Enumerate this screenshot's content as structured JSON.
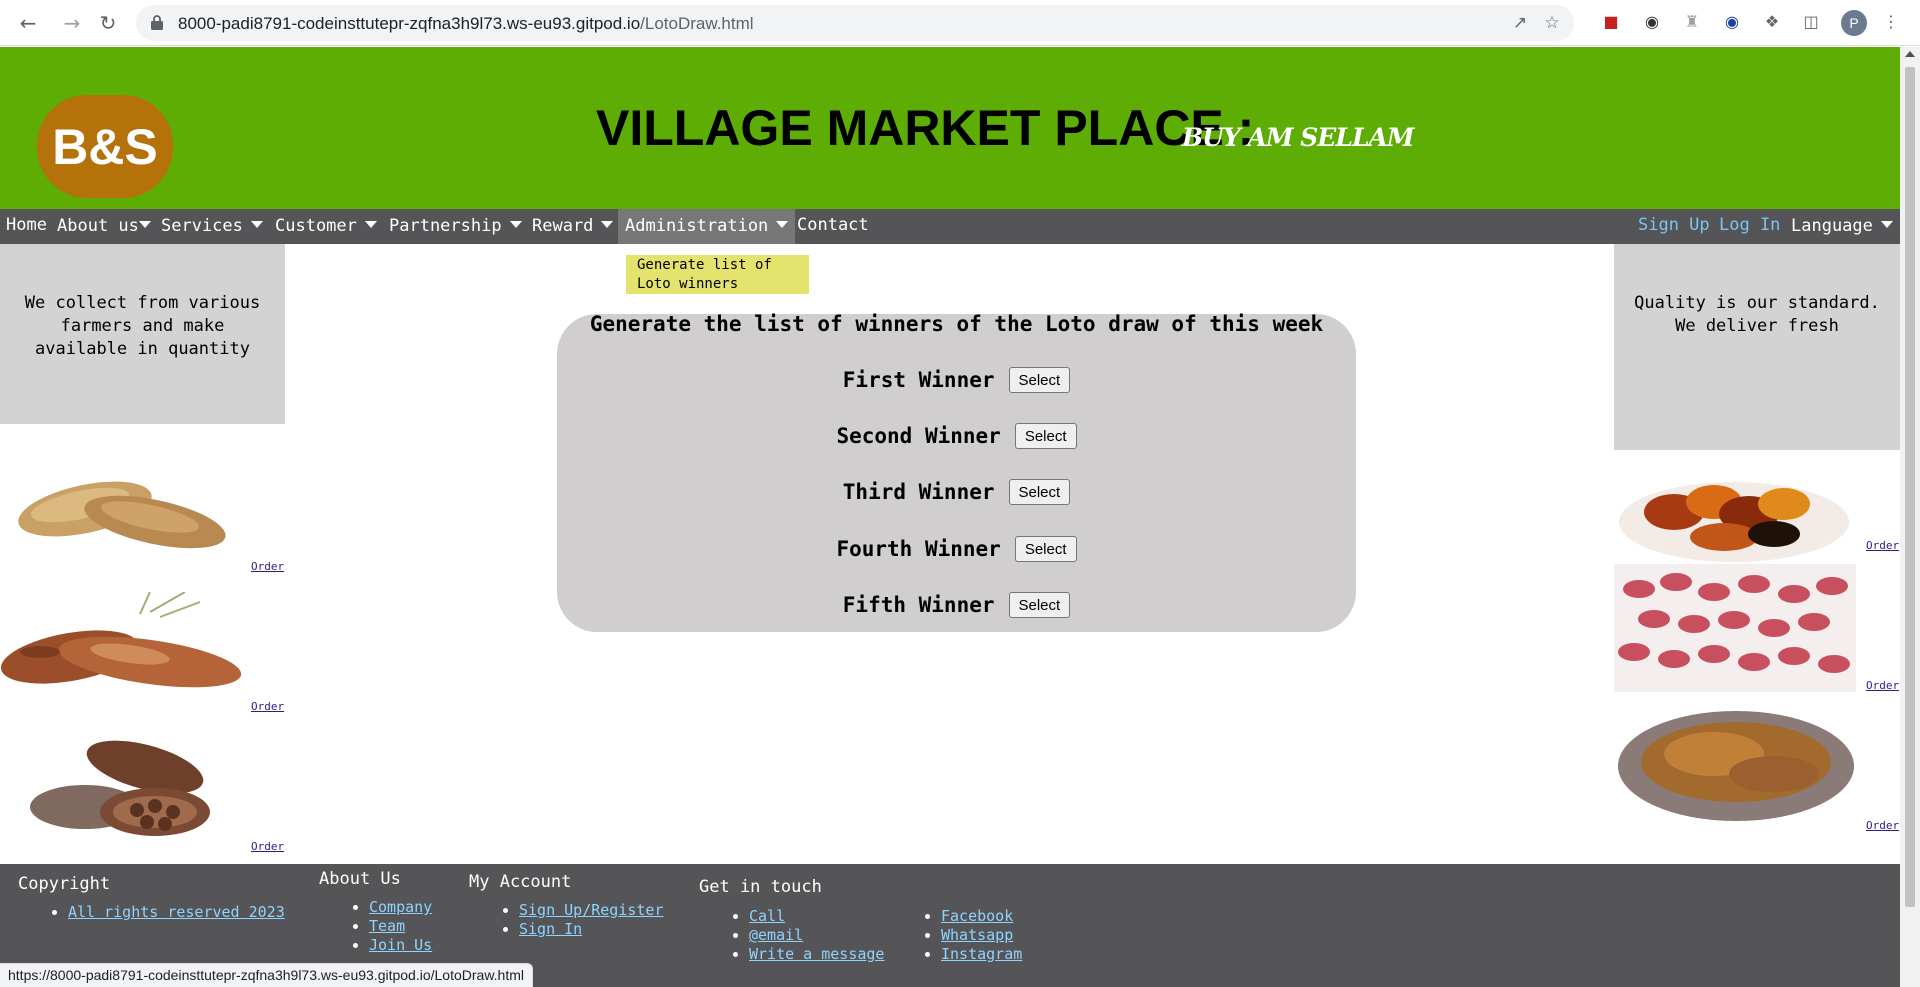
{
  "browser": {
    "url_host": "8000-padi8791-codeinsttutepr-zqfna3h9l73.ws-eu93.gitpod.io",
    "url_path": "/LotoDraw.html",
    "avatar_letter": "P",
    "status_url": "https://8000-padi8791-codeinsttutepr-zqfna3h9l73.ws-eu93.gitpod.io/LotoDraw.html"
  },
  "header": {
    "logo_text": "B&S",
    "title": "VILLAGE MARKET PLACE :",
    "subtitle": "BUY AM SELLAM",
    "colors": {
      "header_bg": "#5ead04",
      "logo_bg": "#b5720a",
      "nav_bg": "#555557"
    }
  },
  "nav": {
    "home": "Home",
    "about": "About us",
    "services": "Services",
    "customer": "Customer",
    "partnership": "Partnership",
    "reward": "Reward",
    "administration": "Administration",
    "contact": "Contact",
    "sign_up": "Sign Up",
    "log_in": "Log In",
    "language": "Language",
    "admin_dropdown": [
      "Generate list of",
      "Loto winners"
    ]
  },
  "left_panel": {
    "lines": [
      "We collect from various",
      "farmers and make",
      "available in quantity"
    ],
    "order_label": "Order"
  },
  "right_panel": {
    "lines": [
      "Quality is our standard.",
      "We deliver fresh"
    ],
    "order_label": "Order"
  },
  "draw": {
    "title": "Generate the list of winners of the Loto draw of this week",
    "winners": [
      {
        "label": "First Winner",
        "button": "Select"
      },
      {
        "label": "Second Winner",
        "button": "Select"
      },
      {
        "label": "Third Winner",
        "button": "Select"
      },
      {
        "label": "Fourth Winner",
        "button": "Select"
      },
      {
        "label": "Fifth Winner",
        "button": "Select"
      }
    ]
  },
  "footer": {
    "copyright": {
      "heading": "Copyright",
      "items": [
        "All rights reserved 2023"
      ]
    },
    "about": {
      "heading": "About Us",
      "items": [
        "Company",
        "Team",
        "Join Us"
      ]
    },
    "account": {
      "heading": "My Account",
      "items": [
        "Sign Up/Register",
        "Sign In"
      ]
    },
    "contact": {
      "heading": "Get in touch",
      "items": [
        "Call",
        "@email",
        "Write a message"
      ]
    },
    "social": {
      "items": [
        "Facebook",
        "Whatsapp",
        "Instagram"
      ]
    }
  }
}
